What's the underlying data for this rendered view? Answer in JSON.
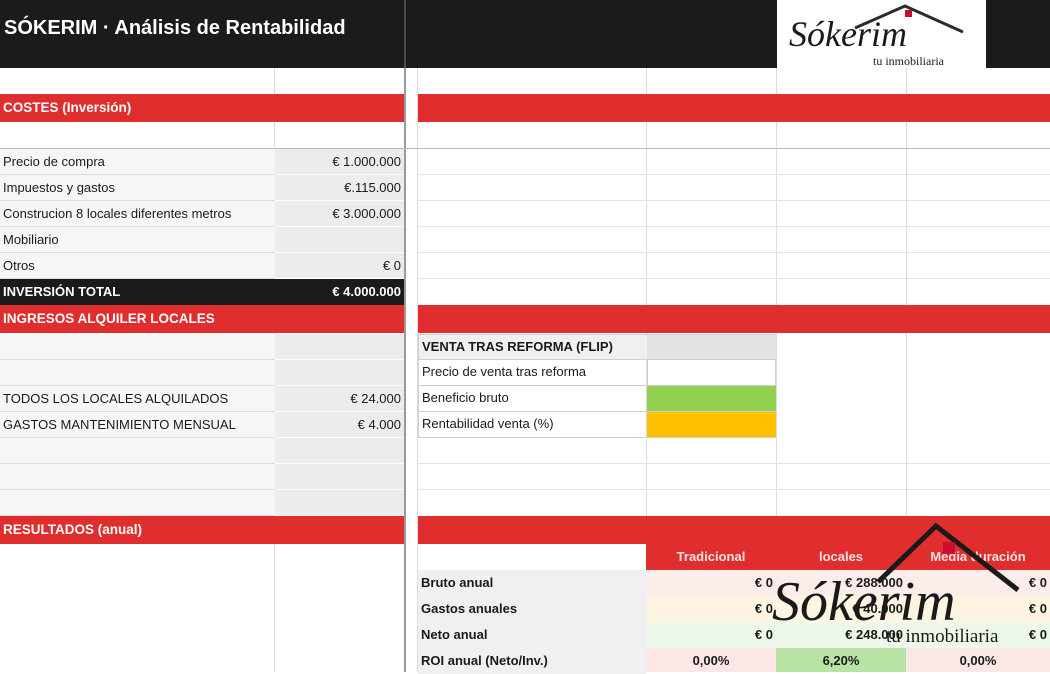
{
  "header": {
    "title": "SÓKERIM · Análisis de Rentabilidad"
  },
  "logo": {
    "brand": "Sókerim",
    "tagline": "tu inmobiliaria"
  },
  "costes": {
    "title": "COSTES (Inversión)",
    "rows": [
      {
        "label": "Precio de compra",
        "value": "€ 1.000.000"
      },
      {
        "label": "Impuestos y gastos",
        "value": "€.115.000"
      },
      {
        "label": "Construcion 8 locales diferentes metros",
        "value": "€ 3.000.000"
      },
      {
        "label": "Mobiliario",
        "value": ""
      },
      {
        "label": "Otros",
        "value": "€ 0"
      }
    ],
    "total_label": "INVERSIÓN TOTAL",
    "total_value": "€ 4.000.000"
  },
  "ingresos": {
    "title": "INGRESOS ALQUILER LOCALES",
    "rows": [
      {
        "label": "TODOS LOS LOCALES ALQUILADOS",
        "value": "€ 24.000"
      },
      {
        "label": "GASTOS MANTENIMIENTO MENSUAL",
        "value": "€ 4.000"
      }
    ]
  },
  "flip": {
    "title": "VENTA TRAS REFORMA (FLIP)",
    "rows": [
      {
        "label": "Precio de venta tras reforma"
      },
      {
        "label": "Beneficio bruto",
        "color": "#92d050"
      },
      {
        "label": "Rentabilidad venta (%)",
        "color": "#ffc000"
      }
    ]
  },
  "resultados": {
    "title": "RESULTADOS (anual)",
    "columns": [
      "Tradicional",
      "locales",
      "Media duración"
    ],
    "rows": [
      {
        "label": "Bruto anual",
        "values": [
          "€ 0",
          "€ 288.000",
          "€ 0"
        ]
      },
      {
        "label": "Gastos anuales",
        "values": [
          "€ 0",
          "€ 40.000",
          "€ 0"
        ]
      },
      {
        "label": "Neto anual",
        "values": [
          "€ 0",
          "€ 248.000",
          "€ 0"
        ]
      },
      {
        "label": "ROI anual (Neto/Inv.)",
        "values": [
          "0,00%",
          "6,20%",
          "0,00%"
        ]
      }
    ]
  },
  "colors": {
    "accent_red": "#e02d2d",
    "header_dark": "#1b1b1b",
    "positive_green": "#92d050",
    "warning_amber": "#ffc000"
  }
}
